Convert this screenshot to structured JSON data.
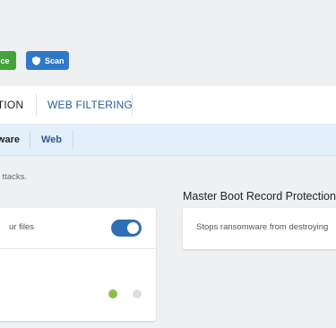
{
  "toolbar": {
    "service_label": "ice",
    "scan_label": "Scan",
    "service_color": "#43a23a",
    "scan_color": "#2f79c8",
    "scan_icon": "shield-icon"
  },
  "tabs": {
    "protection_label": "CTION",
    "web_filtering_label": "WEB FILTERING"
  },
  "subtabs": {
    "ransomware_label": "ware",
    "web_label": "Web"
  },
  "description": "ttacks.",
  "master_boot": {
    "title": "Master Boot Record Protection",
    "text": "Stops ransomware from destroying"
  },
  "left_card": {
    "text": "our files.",
    "toggle_on": true,
    "pager": {
      "current": 1,
      "total": 2
    }
  },
  "colors": {
    "accent": "#2f6fb6",
    "tab_active_bg": "#e3eff9",
    "dot_active": "#8fbd4a"
  }
}
